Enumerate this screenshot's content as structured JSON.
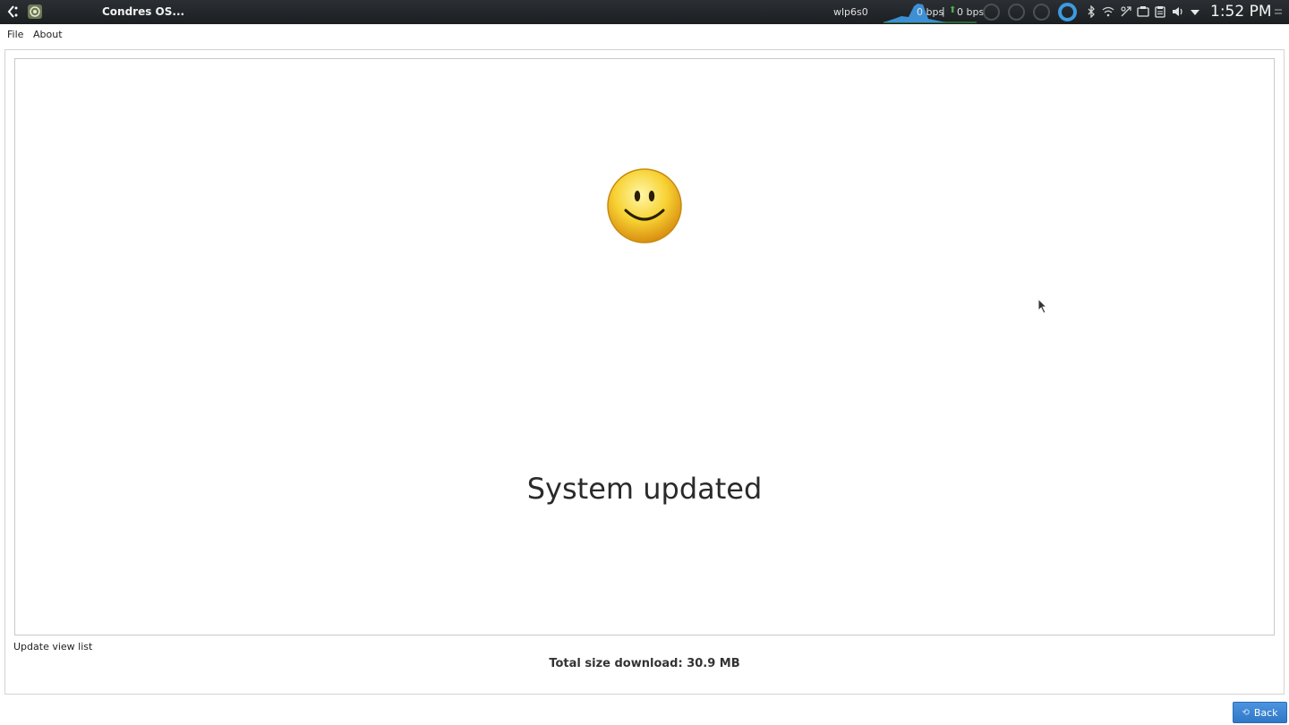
{
  "panel": {
    "task_title": "Condres OS...",
    "network_interface": "wlp6s0",
    "download_rate": "0 bps",
    "separator": "|",
    "upload_rate": "0 bps",
    "clock": "1:52 PM",
    "tray_icons": [
      "bluetooth-icon",
      "wifi-icon",
      "network-icon",
      "screenshot-icon",
      "clipboard-icon",
      "volume-icon",
      "dropdown-icon",
      "menu-icon"
    ],
    "accent_color": "#3d9be0"
  },
  "menubar": {
    "file": "File",
    "about": "About"
  },
  "main": {
    "status_message": "System updated",
    "update_view_list": "Update view list",
    "total_size": "Total size download: 30.9 MB"
  },
  "footer": {
    "back_label": "Back"
  }
}
